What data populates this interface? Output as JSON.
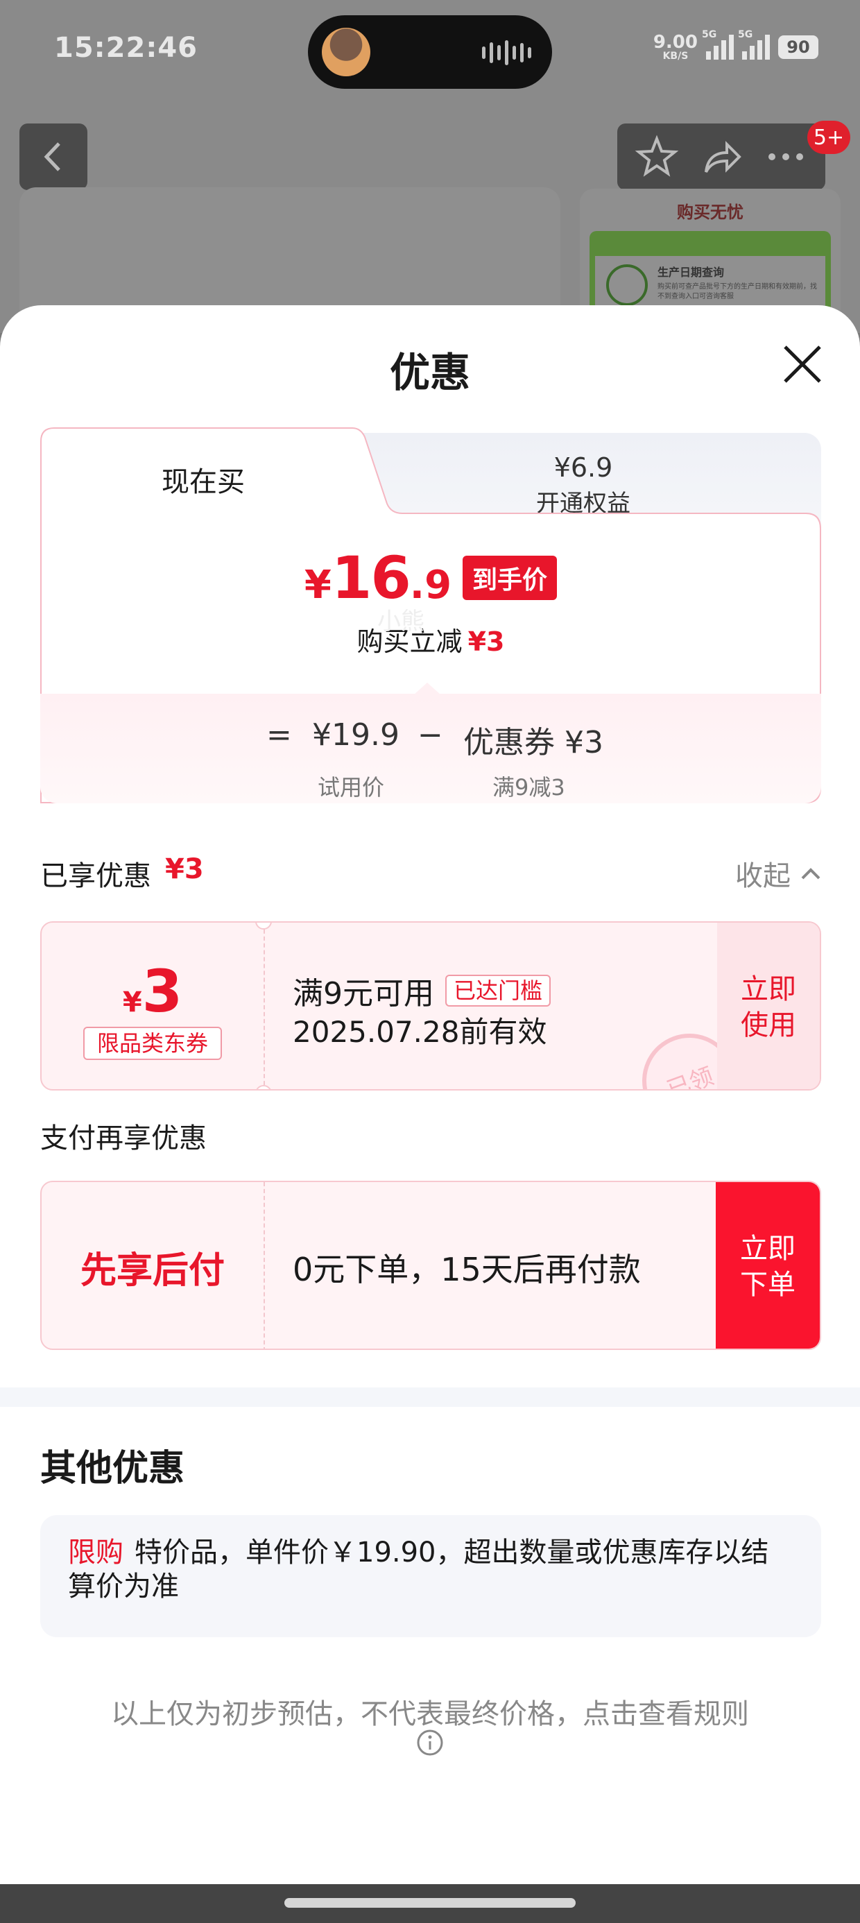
{
  "status_bar": {
    "time": "15:22:46",
    "net_speed": "9.00",
    "net_unit": "KB/S",
    "signal1": "5G",
    "signal2": "5G",
    "battery": "90"
  },
  "background": {
    "notification_badge": "5+",
    "side_card_title": "购买无忧",
    "side_card_item": "生产日期查询",
    "side_card_desc": "购买前可查产品批号下方的生产日期和有效期前，找不到查询入口可咨询客服"
  },
  "sheet": {
    "title": "优惠",
    "tabs": [
      {
        "label": "现在买"
      },
      {
        "price": "¥6.9",
        "label": "开通权益"
      }
    ],
    "final_price": {
      "currency": "¥",
      "integer": "16",
      "decimal": ".9",
      "tag": "到手价"
    },
    "saving": {
      "label": "购买立减",
      "amount": "¥3"
    },
    "breakdown": {
      "equals": "=",
      "base_price": "¥19.9",
      "minus": "−",
      "coupon": "优惠券 ¥3",
      "base_label": "试用价",
      "coupon_rule": "满9减3"
    },
    "enjoyed": {
      "label": "已享优惠",
      "amount": "¥3",
      "collapse": "收起"
    },
    "coupon": {
      "currency": "¥",
      "amount": "3",
      "category": "限品类东券",
      "condition": "满9元可用",
      "reached": "已达门槛",
      "expiry": "2025.07.28前有效",
      "stamp": "已领",
      "use_button": "立即使用",
      "watermark": "小熊"
    },
    "pay": {
      "section_label": "支付再享优惠",
      "name": "先享后付",
      "desc": "0元下单，15天后再付款",
      "button": "立即下单"
    },
    "other": {
      "title": "其他优惠",
      "tag": "限购",
      "text": "特价品，单件价￥19.90，超出数量或优惠库存以结算价为准"
    },
    "footnote": "以上仅为初步预估，不代表最终价格，点击查看规则"
  },
  "colors": {
    "accent": "#e8162b",
    "button": "#fa142e"
  }
}
